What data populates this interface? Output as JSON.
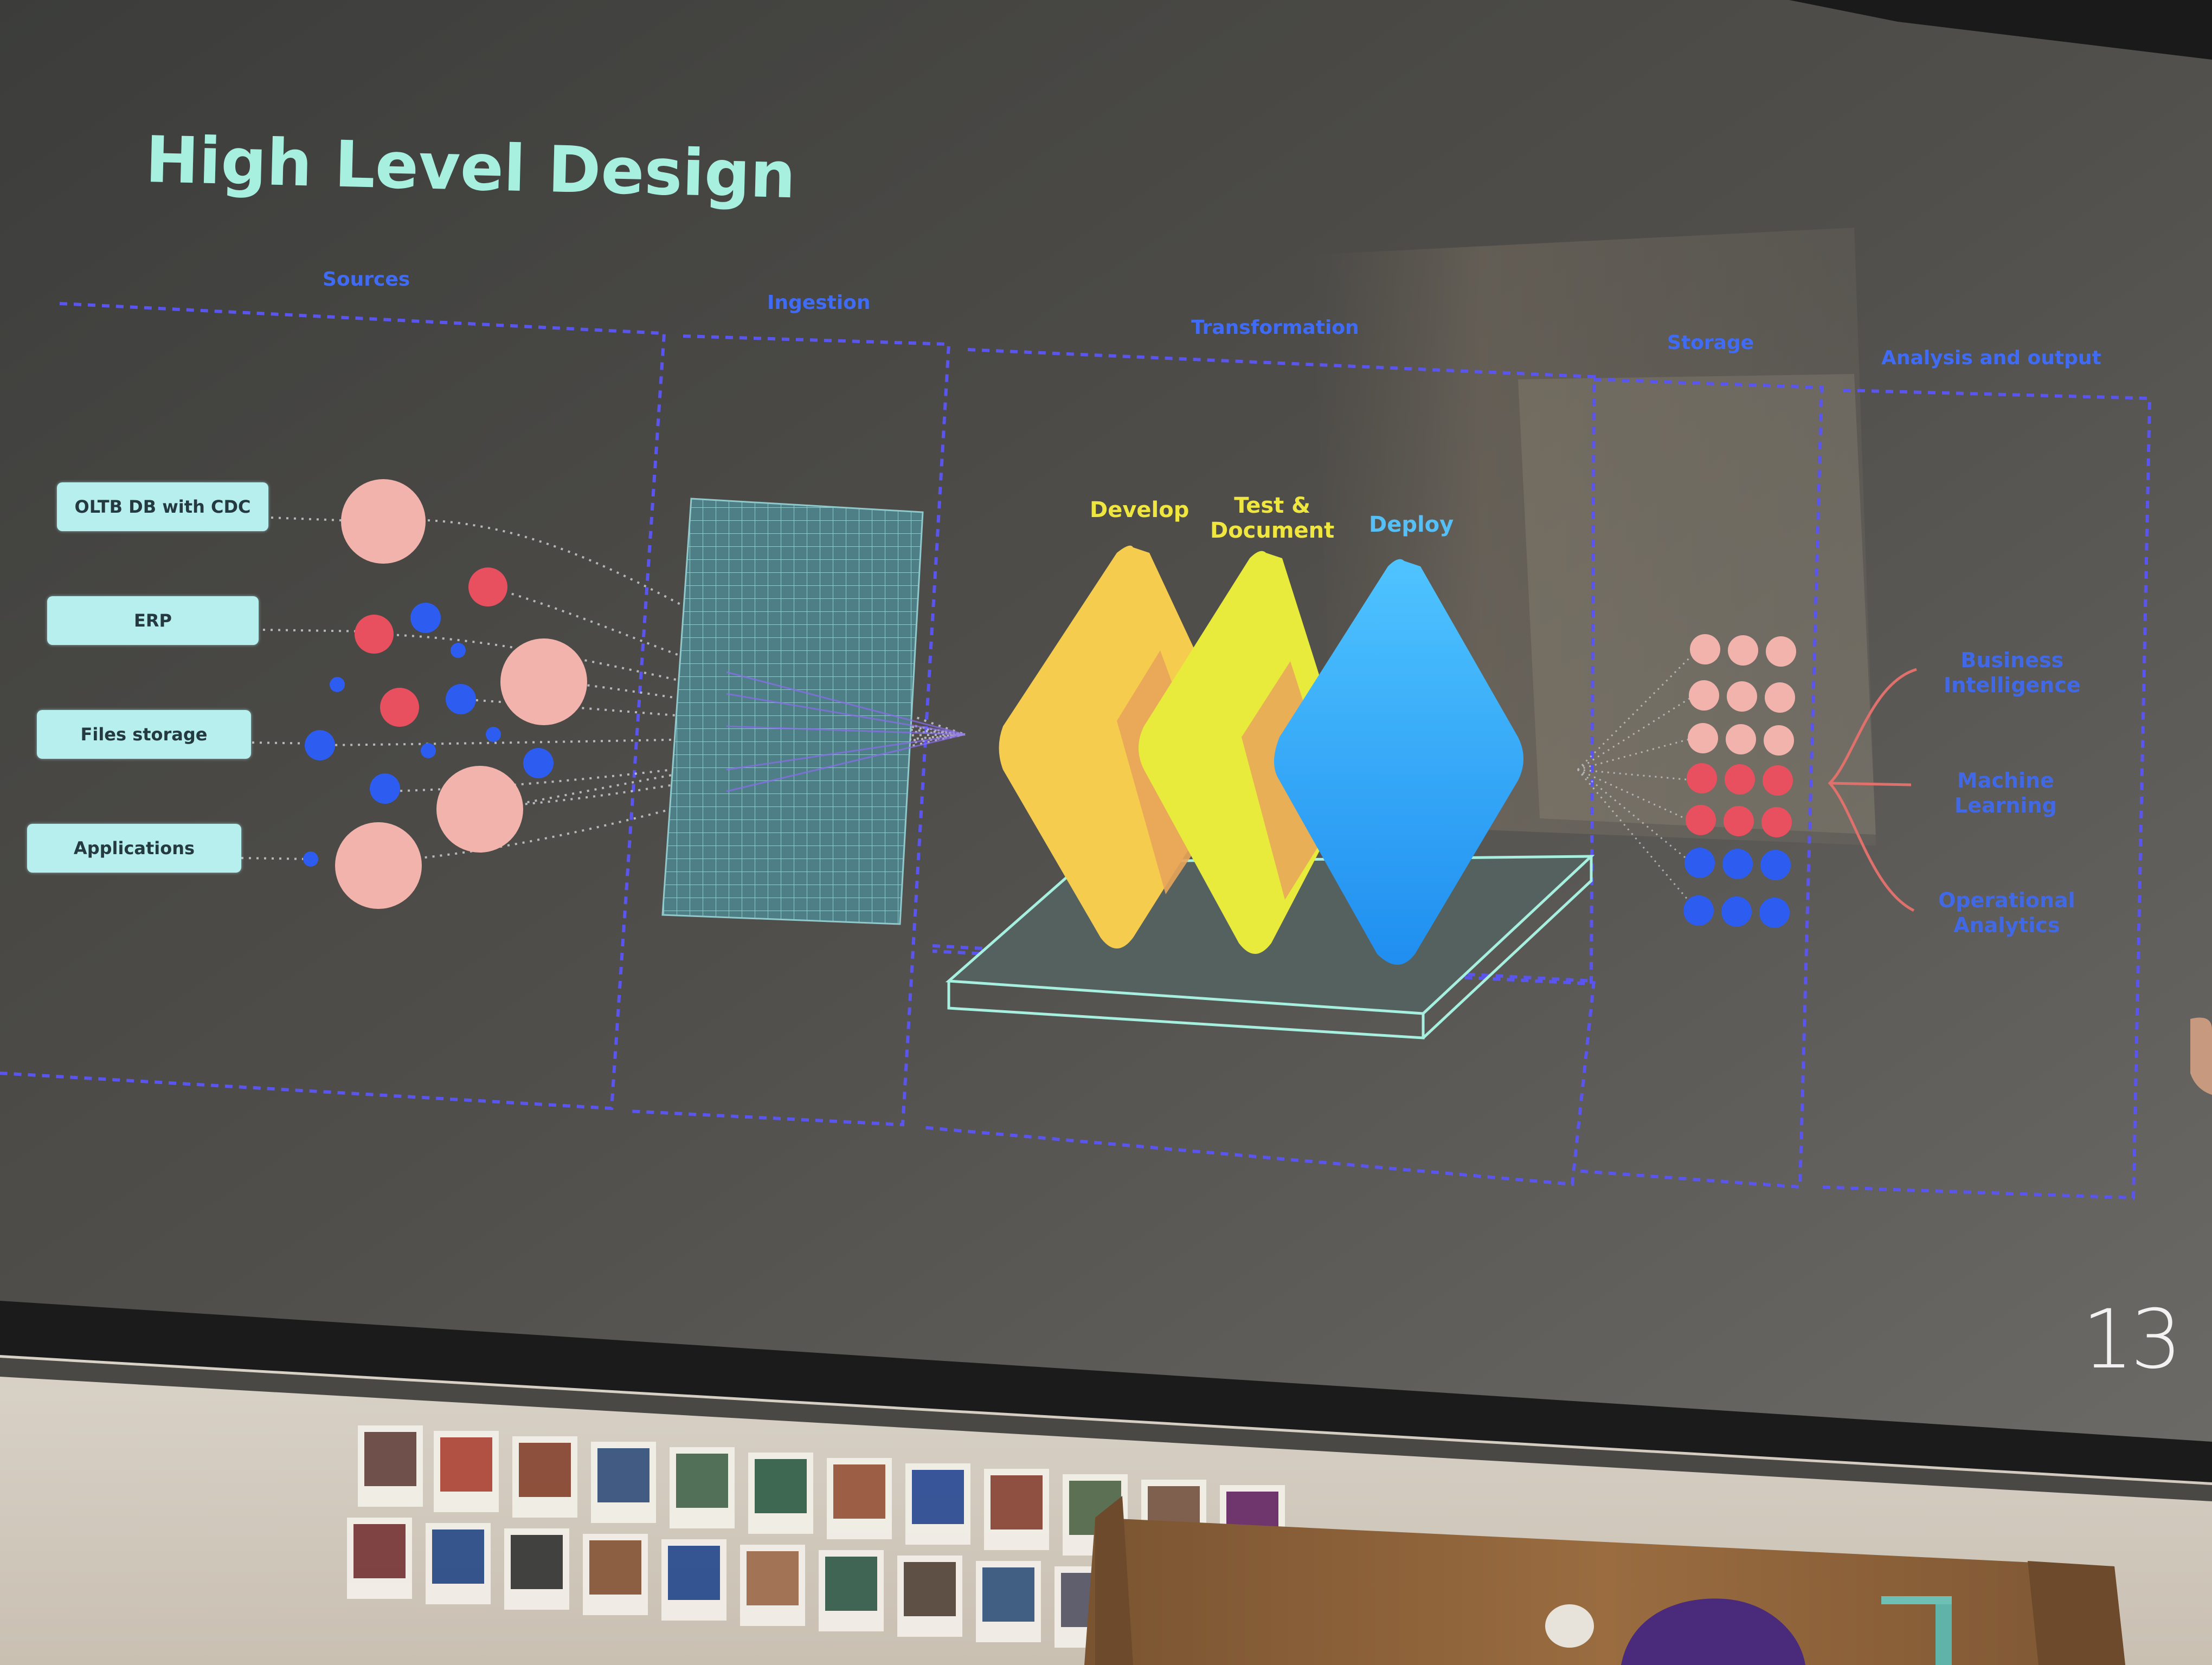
{
  "slide": {
    "title": "High Level Design",
    "page_number": "13",
    "sections": {
      "sources": "Sources",
      "ingestion": "Ingestion",
      "transformation": "Transformation",
      "storage": "Storage",
      "analysis": "Analysis and output"
    },
    "sources": [
      {
        "label": "OLTB DB with CDC"
      },
      {
        "label": "ERP"
      },
      {
        "label": "Files storage"
      },
      {
        "label": "Applications"
      }
    ],
    "stages": {
      "develop": "Develop",
      "test_line1": "Test &",
      "test_line2": "Document",
      "deploy": "Deploy"
    },
    "outputs": [
      {
        "line1": "Business",
        "line2": "Intelligence"
      },
      {
        "line1": "Machine",
        "line2": "Learning"
      },
      {
        "line1": "Operational",
        "line2": "Analytics"
      }
    ],
    "colors": {
      "title": "#a7f0e0",
      "section_label": "#3f6bf5",
      "dashed_frame": "#5b55f0",
      "source_box": "#b6efee",
      "develop": "#f5cc4e",
      "test": "#e8ea3c",
      "deploy": "#2fa8f5",
      "pink": "#f2b3ac",
      "red": "#e8505f",
      "blue": "#2d5cf0"
    }
  }
}
